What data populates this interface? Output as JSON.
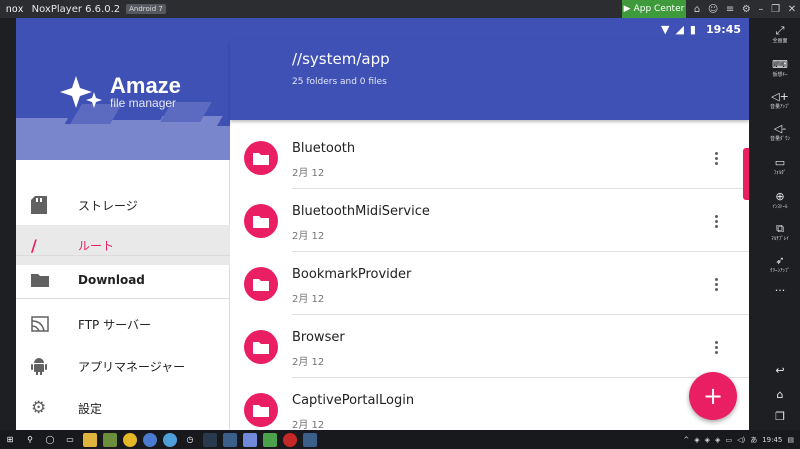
{
  "window": {
    "logo_text": "nox",
    "title": "NoxPlayer 6.6.0.2",
    "android_badge": "Android 7",
    "app_center_label": "App Center"
  },
  "status_bar": {
    "time": "19:45"
  },
  "drawer": {
    "brand_name": "Amaze",
    "brand_sub": "file manager",
    "items": [
      {
        "label": "ストレージ",
        "icon": "sd-card-icon"
      },
      {
        "label": "ルート",
        "icon": "slash-icon",
        "active": true
      },
      {
        "label": "Download",
        "icon": "folder-icon"
      },
      {
        "label": "FTP サーバー",
        "icon": "ftp-icon"
      },
      {
        "label": "アプリマネージャー",
        "icon": "android-icon"
      },
      {
        "label": "設定",
        "icon": "gear-icon"
      }
    ]
  },
  "toolbar": {
    "path": "//system/app",
    "count": "25 folders and 0 files"
  },
  "files": [
    {
      "name": "Bluetooth",
      "date": "2月 12"
    },
    {
      "name": "BluetoothMidiService",
      "date": "2月 12"
    },
    {
      "name": "BookmarkProvider",
      "date": "2月 12"
    },
    {
      "name": "Browser",
      "date": "2月 12"
    },
    {
      "name": "CaptivePortalLogin",
      "date": "2月 12"
    }
  ],
  "fab_label": "+",
  "nox_sidebar": [
    {
      "label": "全画面",
      "icon": "fullscreen-icon"
    },
    {
      "label": "仮想ｷｰ",
      "icon": "keyboard-icon"
    },
    {
      "label": "音量ｱｯﾌﾟ",
      "icon": "volume-up-icon"
    },
    {
      "label": "音量ﾀﾞｳﾝ",
      "icon": "volume-down-icon"
    },
    {
      "label": "ﾌｫﾙﾀﾞ",
      "icon": "monitor-icon"
    },
    {
      "label": "ｲﾝｽﾄｰﾙ",
      "icon": "install-icon"
    },
    {
      "label": "ﾏﾙﾁﾌﾟﾚｲ",
      "icon": "multiplay-icon"
    },
    {
      "label": "ｸﾘｰﾝｱｯﾌﾟ",
      "icon": "rocket-icon"
    },
    {
      "label": "",
      "icon": "more-icon"
    }
  ],
  "taskbar": {
    "time": "19:45"
  },
  "colors": {
    "primary": "#3f51b5",
    "accent": "#e91e63"
  }
}
